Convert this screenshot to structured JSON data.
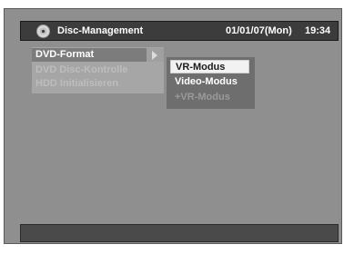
{
  "header": {
    "icon": "disc-icon",
    "title": "Disc-Management",
    "date": "01/01/07(Mon)",
    "time": "19:34"
  },
  "menu": {
    "items": [
      {
        "label": "DVD-Format",
        "state": "selected",
        "has_submenu": true
      },
      {
        "label": "DVD Disc-Kontrolle",
        "state": "disabled"
      },
      {
        "label": "HDD Initialisieren",
        "state": "disabled"
      }
    ]
  },
  "submenu": {
    "items": [
      {
        "label": "VR-Modus",
        "state": "selected"
      },
      {
        "label": "Video-Modus",
        "state": "enabled"
      },
      {
        "label": "+VR-Modus",
        "state": "disabled"
      }
    ]
  },
  "status_bar": {
    "text": ""
  },
  "colors": {
    "frame": "#8f8f8f",
    "title_bar": "#3c3c3c",
    "menu_panel": "#a6a6a6",
    "submenu": "#6e6e6e",
    "selection": "#f2f2f2"
  }
}
